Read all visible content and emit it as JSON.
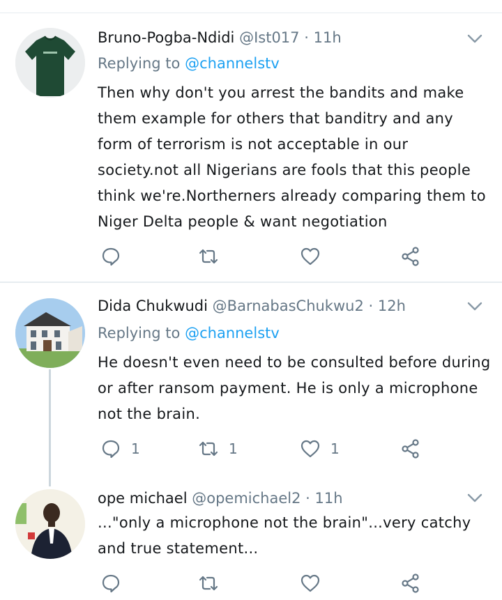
{
  "tweets": [
    {
      "name": "Bruno-Pogba-Ndidi",
      "handle": "@Ist017",
      "separator": "·",
      "time": "11h",
      "replying_prefix": "Replying to",
      "replying_to": "@channelstv",
      "text": "Then why don't you arrest the bandits and make them example for others that banditry and any form of terrorism is not acceptable in our society.not all Nigerians are fools that this people think we're.Northerners already comparing them to Niger Delta people & want negotiation",
      "reply_count": "",
      "retweet_count": "",
      "like_count": ""
    },
    {
      "name": "Dida Chukwudi",
      "handle": "@BarnabasChukwu2",
      "separator": "·",
      "time": "12h",
      "replying_prefix": "Replying to",
      "replying_to": "@channelstv",
      "text": "He doesn't even need to be consulted before during or after ransom payment. He is only a microphone not the brain.",
      "reply_count": "1",
      "retweet_count": "1",
      "like_count": "1"
    },
    {
      "name": "ope michael",
      "handle": "@opemichael2",
      "separator": "·",
      "time": "11h",
      "text": "...\"only a microphone not the brain\"...very catchy and true statement...",
      "reply_count": "",
      "retweet_count": "",
      "like_count": ""
    }
  ],
  "icons": {
    "reply": "reply-icon",
    "retweet": "retweet-icon",
    "like": "heart-icon",
    "share": "share-icon",
    "more": "chevron-down-icon"
  },
  "colors": {
    "text": "#14171a",
    "secondary": "#657786",
    "link": "#1da1f2",
    "icon": "#657786",
    "divider": "#e6ecf0"
  }
}
